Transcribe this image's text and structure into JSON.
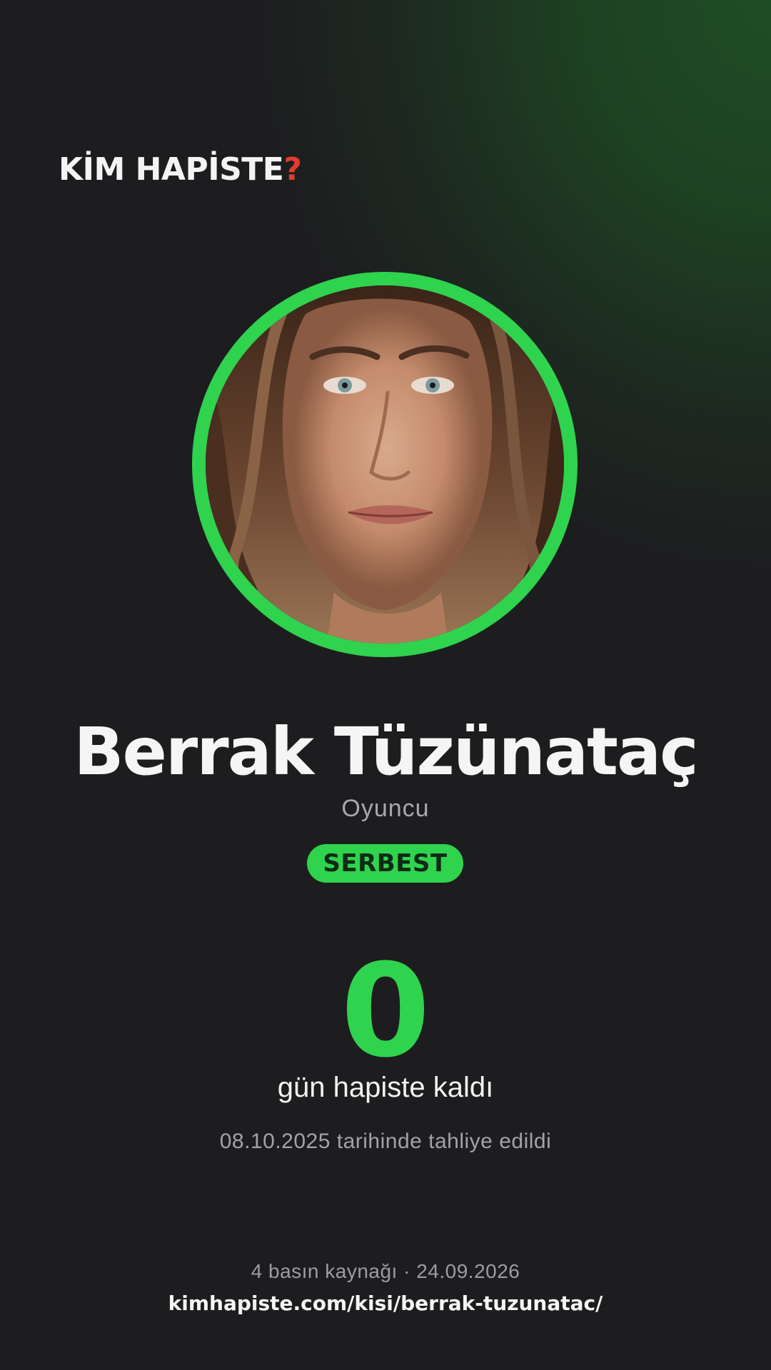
{
  "brand": {
    "name": "KİM HAPİSTE",
    "mark": "?",
    "mark_color": "#e53a2f"
  },
  "profile": {
    "photo_icon": "portrait-photo",
    "ring_color": "#2fd34e",
    "name": "Berrak Tüzünataç",
    "role": "Oyuncu",
    "status_badge": "SERBEST",
    "status_color": "#2fd34e"
  },
  "stats": {
    "days": "0",
    "days_label": "gün hapiste kaldı",
    "release_text": "08.10.2025 tarihinde tahliye edildi"
  },
  "footer": {
    "sources_text": "4 basın kaynağı · 24.09.2026",
    "url": "kimhapiste.com/kisi/berrak-tuzunatac/"
  }
}
